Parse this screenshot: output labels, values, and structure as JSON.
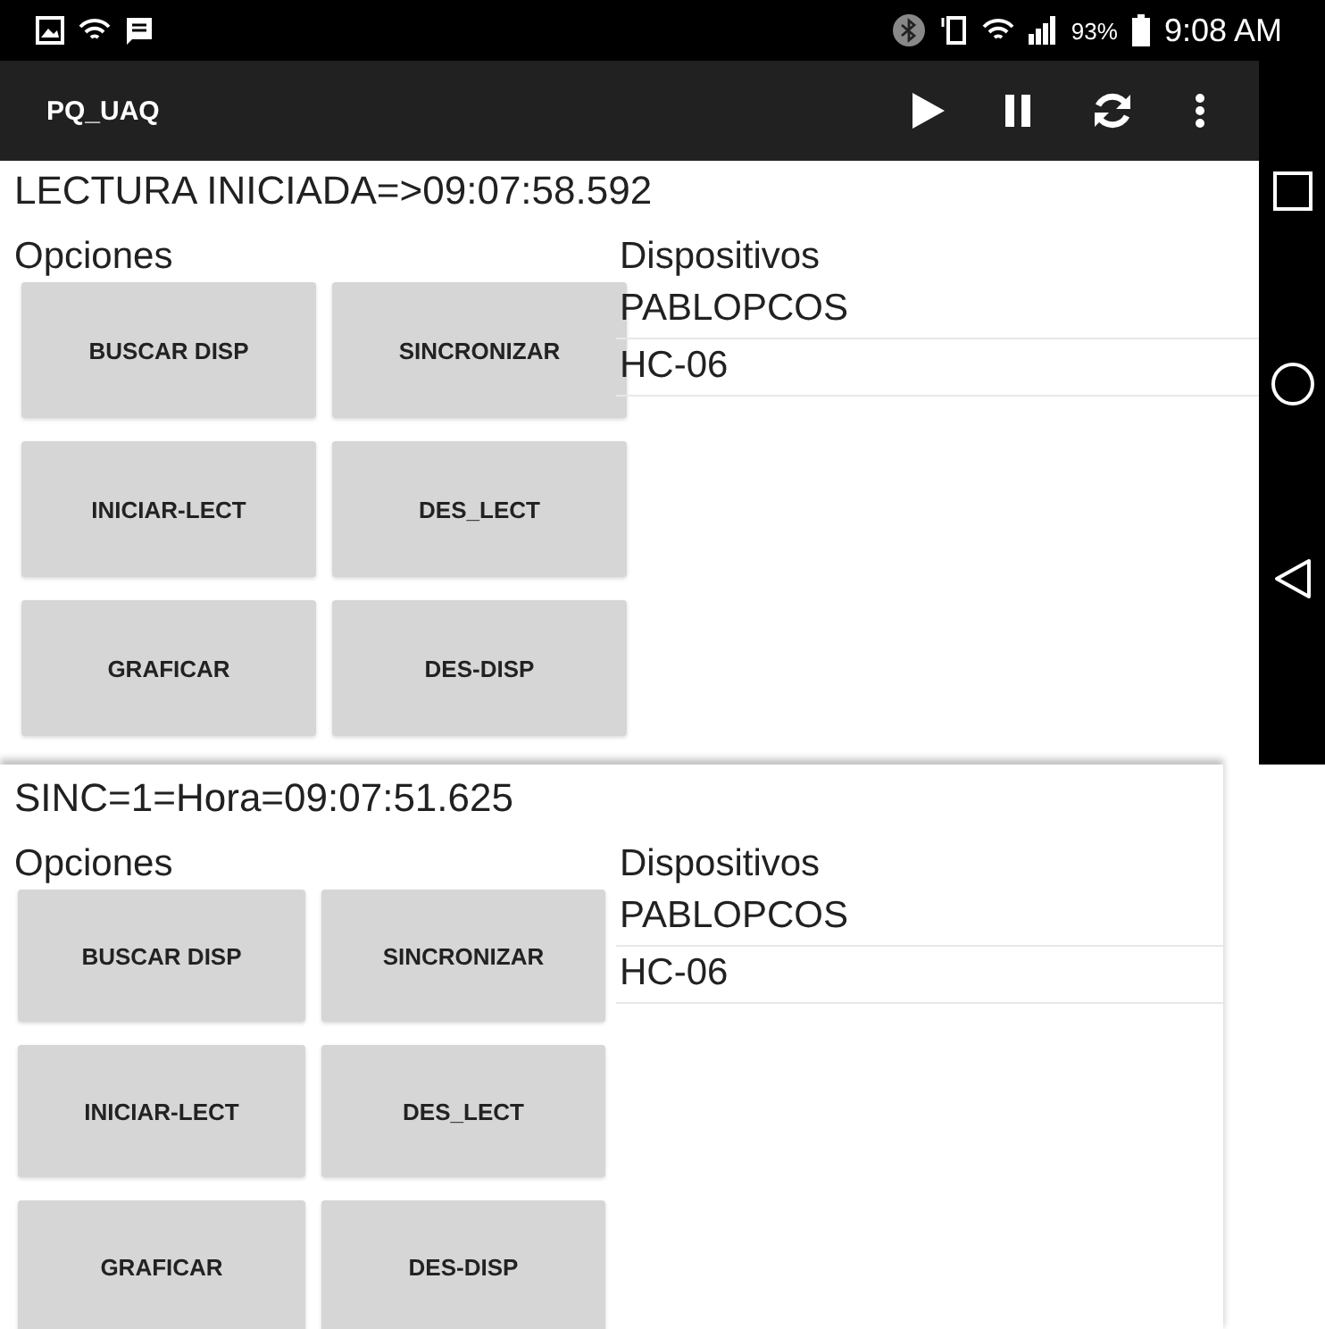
{
  "status_bar": {
    "battery": "93%",
    "time": "9:08 AM"
  },
  "app_bar": {
    "title": "PQ_UAQ"
  },
  "panels": [
    {
      "status": "LECTURA INICIADA=>09:07:58.592",
      "options_label": "Opciones",
      "buttons": [
        "BUSCAR DISP",
        "SINCRONIZAR",
        "INICIAR-LECT",
        "DES_LECT",
        "GRAFICAR",
        "DES-DISP"
      ],
      "devices_label": "Dispositivos",
      "devices": [
        "PABLOPCOS",
        "HC-06"
      ]
    },
    {
      "status": "SINC=1=Hora=09:07:51.625",
      "options_label": "Opciones",
      "buttons": [
        "BUSCAR DISP",
        "SINCRONIZAR",
        "INICIAR-LECT",
        "DES_LECT",
        "GRAFICAR",
        "DES-DISP"
      ],
      "devices_label": "Dispositivos",
      "devices": [
        "PABLOPCOS",
        "HC-06"
      ]
    }
  ]
}
